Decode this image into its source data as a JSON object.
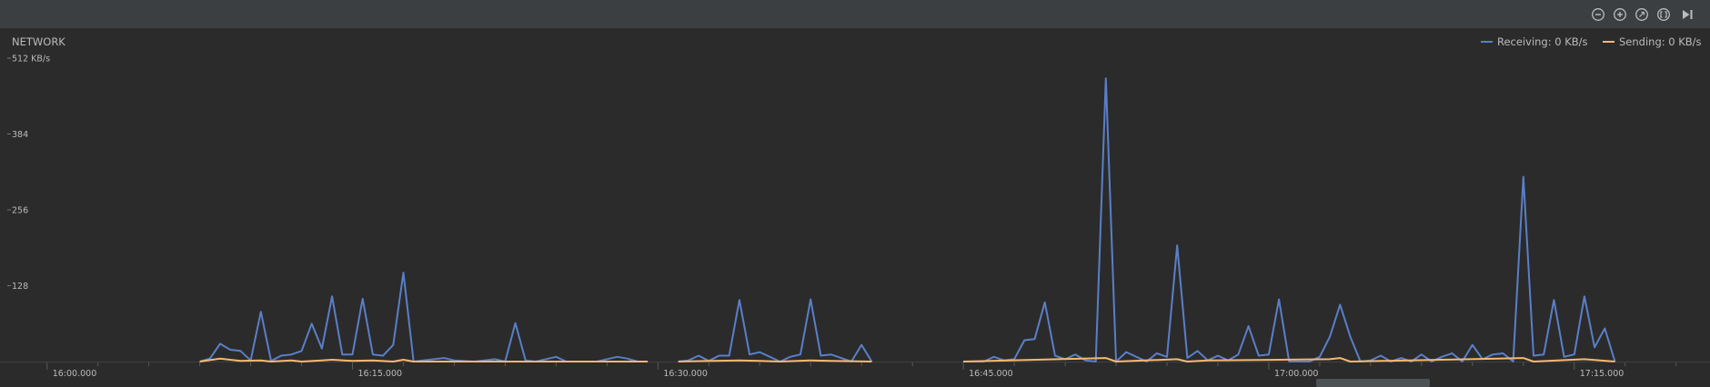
{
  "toolbar": {
    "buttons": [
      {
        "name": "zoom-out-button",
        "icon": "zoom-out-icon"
      },
      {
        "name": "zoom-in-button",
        "icon": "zoom-in-icon"
      },
      {
        "name": "reset-zoom-button",
        "icon": "reset-zoom-icon"
      },
      {
        "name": "zoom-to-selection-button",
        "icon": "zoom-to-selection-icon"
      },
      {
        "name": "go-live-button",
        "icon": "skip-to-end-icon"
      }
    ]
  },
  "monitor": {
    "title": "NETWORK",
    "unit_label": "512 KB/s",
    "legend": {
      "receiving": "Receiving: 0 KB/s",
      "sending": "Sending: 0 KB/s"
    }
  },
  "colors": {
    "receiving": "#5a7fc8",
    "sending": "#f5b971",
    "background": "#2b2b2b",
    "toolbar": "#3c3f41",
    "text": "#bbbbbb"
  },
  "chart_data": {
    "type": "line",
    "title": "NETWORK",
    "ylabel": "",
    "xlabel": "",
    "ylim": [
      0,
      512
    ],
    "xlim": [
      "15:58:35",
      "17:21:40"
    ],
    "y_ticks": [
      {
        "value": 128,
        "label": "128"
      },
      {
        "value": 256,
        "label": "256"
      },
      {
        "value": 384,
        "label": "384"
      },
      {
        "value": 512,
        "label": "512 KB/s"
      }
    ],
    "x_ticks": [
      {
        "value": "16:00:00",
        "label": "16:00.000"
      },
      {
        "value": "16:15:00",
        "label": "16:15.000"
      },
      {
        "value": "16:30:00",
        "label": "16:30.000"
      },
      {
        "value": "16:45:00",
        "label": "16:45.000"
      },
      {
        "value": "17:00:00",
        "label": "17:00.000"
      },
      {
        "value": "17:15:00",
        "label": "17:15.000"
      }
    ],
    "series": [
      {
        "name": "Receiving",
        "segments": [
          [
            [
              "16:07:30",
              0
            ],
            [
              "16:08:00",
              5
            ],
            [
              "16:08:30",
              30
            ],
            [
              "16:09:00",
              20
            ],
            [
              "16:09:30",
              18
            ],
            [
              "16:10:00",
              2
            ],
            [
              "16:10:30",
              84
            ],
            [
              "16:11:00",
              1
            ],
            [
              "16:11:30",
              10
            ],
            [
              "16:12:00",
              12
            ],
            [
              "16:12:30",
              18
            ],
            [
              "16:13:00",
              64
            ],
            [
              "16:13:30",
              22
            ],
            [
              "16:14:00",
              110
            ],
            [
              "16:14:30",
              12
            ],
            [
              "16:15:00",
              12
            ],
            [
              "16:15:30",
              106
            ],
            [
              "16:16:00",
              12
            ],
            [
              "16:16:30",
              10
            ],
            [
              "16:17:00",
              28
            ],
            [
              "16:17:30",
              150
            ],
            [
              "16:18:00",
              0
            ],
            [
              "16:19:00",
              4
            ],
            [
              "16:19:30",
              6
            ],
            [
              "16:20:00",
              2
            ],
            [
              "16:21:00",
              0
            ],
            [
              "16:22:00",
              4
            ],
            [
              "16:22:30",
              0
            ],
            [
              "16:23:00",
              65
            ],
            [
              "16:23:30",
              2
            ],
            [
              "16:24:00",
              0
            ],
            [
              "16:25:00",
              8
            ],
            [
              "16:25:30",
              0
            ],
            [
              "16:26:00",
              0
            ],
            [
              "16:27:00",
              0
            ],
            [
              "16:28:00",
              8
            ],
            [
              "16:28:30",
              5
            ],
            [
              "16:29:00",
              0
            ],
            [
              "16:29:30",
              0
            ]
          ],
          [
            [
              "16:31:00",
              0
            ],
            [
              "16:31:30",
              2
            ],
            [
              "16:32:00",
              10
            ],
            [
              "16:32:30",
              1
            ],
            [
              "16:33:00",
              10
            ],
            [
              "16:33:30",
              10
            ],
            [
              "16:34:00",
              104
            ],
            [
              "16:34:30",
              12
            ],
            [
              "16:35:00",
              16
            ],
            [
              "16:35:30",
              8
            ],
            [
              "16:36:00",
              0
            ],
            [
              "16:36:30",
              8
            ],
            [
              "16:37:00",
              12
            ],
            [
              "16:37:30",
              105
            ],
            [
              "16:38:00",
              10
            ],
            [
              "16:38:30",
              12
            ],
            [
              "16:39:00",
              6
            ],
            [
              "16:39:30",
              0
            ],
            [
              "16:40:00",
              28
            ],
            [
              "16:40:30",
              0
            ]
          ],
          [
            [
              "16:45:00",
              0
            ],
            [
              "16:46:00",
              0
            ],
            [
              "16:46:30",
              8
            ],
            [
              "16:47:00",
              2
            ],
            [
              "16:47:30",
              4
            ],
            [
              "16:48:00",
              36
            ],
            [
              "16:48:30",
              38
            ],
            [
              "16:49:00",
              100
            ],
            [
              "16:49:30",
              10
            ],
            [
              "16:50:00",
              4
            ],
            [
              "16:50:30",
              12
            ],
            [
              "16:51:00",
              2
            ],
            [
              "16:51:30",
              0
            ],
            [
              "16:52:00",
              478
            ],
            [
              "16:52:30",
              0
            ],
            [
              "16:53:00",
              16
            ],
            [
              "16:53:30",
              8
            ],
            [
              "16:54:00",
              0
            ],
            [
              "16:54:30",
              14
            ],
            [
              "16:55:00",
              8
            ],
            [
              "16:55:30",
              196
            ],
            [
              "16:56:00",
              6
            ],
            [
              "16:56:30",
              18
            ],
            [
              "16:57:00",
              2
            ],
            [
              "16:57:30",
              10
            ],
            [
              "16:58:00",
              2
            ],
            [
              "16:58:30",
              12
            ],
            [
              "16:59:00",
              60
            ],
            [
              "16:59:30",
              10
            ],
            [
              "17:00:00",
              12
            ],
            [
              "17:00:30",
              105
            ],
            [
              "17:01:00",
              0
            ],
            [
              "17:02:00",
              0
            ],
            [
              "17:02:30",
              8
            ],
            [
              "17:03:00",
              42
            ],
            [
              "17:03:30",
              96
            ],
            [
              "17:04:00",
              42
            ],
            [
              "17:04:30",
              0
            ],
            [
              "17:05:00",
              2
            ],
            [
              "17:05:30",
              10
            ],
            [
              "17:06:00",
              0
            ],
            [
              "17:06:30",
              6
            ],
            [
              "17:07:00",
              0
            ],
            [
              "17:07:30",
              12
            ],
            [
              "17:08:00",
              0
            ],
            [
              "17:08:30",
              8
            ],
            [
              "17:09:00",
              14
            ],
            [
              "17:09:30",
              0
            ],
            [
              "17:10:00",
              28
            ],
            [
              "17:10:30",
              4
            ],
            [
              "17:11:00",
              12
            ],
            [
              "17:11:30",
              14
            ],
            [
              "17:12:00",
              0
            ],
            [
              "17:12:30",
              312
            ],
            [
              "17:13:00",
              10
            ],
            [
              "17:13:30",
              12
            ],
            [
              "17:14:00",
              104
            ],
            [
              "17:14:30",
              8
            ],
            [
              "17:15:00",
              12
            ],
            [
              "17:15:30",
              110
            ],
            [
              "17:16:00",
              24
            ],
            [
              "17:16:30",
              56
            ],
            [
              "17:17:00",
              0
            ]
          ]
        ]
      },
      {
        "name": "Sending",
        "segments": [
          [
            [
              "16:07:30",
              0
            ],
            [
              "16:08:30",
              5
            ],
            [
              "16:09:30",
              1
            ],
            [
              "16:10:30",
              2
            ],
            [
              "16:11:00",
              0
            ],
            [
              "16:12:00",
              2
            ],
            [
              "16:12:30",
              0
            ],
            [
              "16:13:30",
              2
            ],
            [
              "16:14:00",
              3
            ],
            [
              "16:15:00",
              1
            ],
            [
              "16:16:00",
              2
            ],
            [
              "16:17:00",
              0
            ],
            [
              "16:17:30",
              3
            ],
            [
              "16:18:00",
              0
            ],
            [
              "16:29:30",
              0
            ]
          ],
          [
            [
              "16:31:00",
              0
            ],
            [
              "16:34:00",
              2
            ],
            [
              "16:35:00",
              1
            ],
            [
              "16:36:00",
              0
            ],
            [
              "16:37:30",
              2
            ],
            [
              "16:38:30",
              1
            ],
            [
              "16:40:30",
              0
            ]
          ],
          [
            [
              "16:45:00",
              0
            ],
            [
              "16:52:00",
              6
            ],
            [
              "16:52:30",
              0
            ],
            [
              "16:55:30",
              4
            ],
            [
              "16:56:00",
              0
            ],
            [
              "16:57:00",
              2
            ],
            [
              "17:00:30",
              3
            ],
            [
              "17:03:00",
              4
            ],
            [
              "17:03:30",
              6
            ],
            [
              "17:04:00",
              0
            ],
            [
              "17:12:30",
              6
            ],
            [
              "17:13:00",
              0
            ],
            [
              "17:15:30",
              4
            ],
            [
              "17:17:00",
              0
            ]
          ]
        ]
      }
    ]
  }
}
